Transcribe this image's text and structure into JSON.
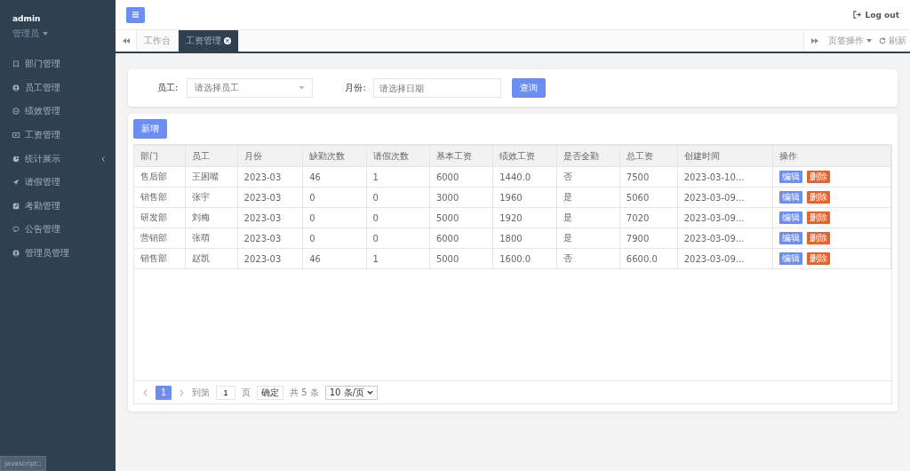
{
  "user": {
    "name": "admin",
    "role": "管理员"
  },
  "sidebar": {
    "items": [
      {
        "label": "部门管理",
        "expandable": false
      },
      {
        "label": "员工管理",
        "expandable": false
      },
      {
        "label": "绩效管理",
        "expandable": false
      },
      {
        "label": "工资管理",
        "expandable": false
      },
      {
        "label": "统计展示",
        "expandable": true
      },
      {
        "label": "请假管理",
        "expandable": false
      },
      {
        "label": "考勤管理",
        "expandable": false
      },
      {
        "label": "公告管理",
        "expandable": false
      },
      {
        "label": "管理员管理",
        "expandable": false
      }
    ]
  },
  "topbar": {
    "logout": "Log out"
  },
  "tabs": [
    {
      "label": "工作台",
      "selected": false,
      "closable": false
    },
    {
      "label": "工资管理",
      "selected": true,
      "closable": true
    }
  ],
  "tab_actions": {
    "page_ops": "页签操作",
    "refresh": "刷新"
  },
  "filters": {
    "employee_label": "员工:",
    "employee_placeholder": "请选择员工",
    "month_label": "月份:",
    "month_placeholder": "请选择日期",
    "query": "查询"
  },
  "add_button": "新增",
  "table": {
    "columns": [
      "部门",
      "员工",
      "月份",
      "缺勤次数",
      "请假次数",
      "基本工资",
      "绩效工资",
      "是否全勤",
      "总工资",
      "创建时间",
      "操作"
    ],
    "rows": [
      {
        "cells": [
          "售后部",
          "王困嘴",
          "2023-03",
          "46",
          "1",
          "6000",
          "1440.0",
          "否",
          "7500",
          "2023-03-10..."
        ],
        "actions": [
          "编辑",
          "删除"
        ]
      },
      {
        "cells": [
          "销售部",
          "张宇",
          "2023-03",
          "0",
          "0",
          "3000",
          "1960",
          "是",
          "5060",
          "2023-03-09..."
        ],
        "actions": [
          "编辑",
          "删除"
        ]
      },
      {
        "cells": [
          "研发部",
          "刘梅",
          "2023-03",
          "0",
          "0",
          "5000",
          "1920",
          "是",
          "7020",
          "2023-03-09..."
        ],
        "actions": [
          "编辑",
          "删除"
        ]
      },
      {
        "cells": [
          "营销部",
          "张萌",
          "2023-03",
          "0",
          "0",
          "6000",
          "1800",
          "是",
          "7900",
          "2023-03-09..."
        ],
        "actions": [
          "编辑",
          "删除"
        ]
      },
      {
        "cells": [
          "销售部",
          "赵凯",
          "2023-03",
          "46",
          "1",
          "5000",
          "1600.0",
          "否",
          "6600.0",
          "2023-03-09..."
        ],
        "actions": [
          "编辑",
          "删除"
        ]
      }
    ]
  },
  "pagination": {
    "page": "1",
    "goto": "到第",
    "goto_value": "1",
    "page_unit": "页",
    "confirm": "确定",
    "total": "共 5 条",
    "page_size": "10 条/页"
  },
  "status_bar": "javascript:;"
}
